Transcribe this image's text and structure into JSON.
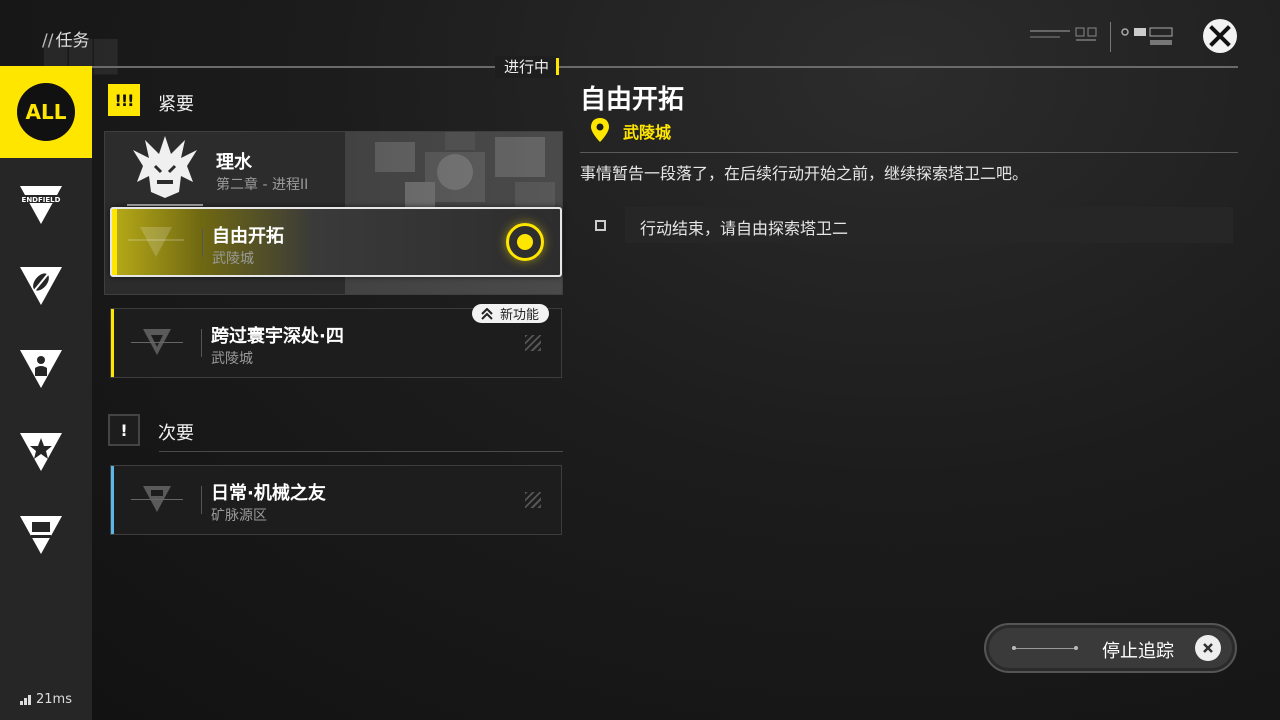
{
  "header": {
    "title": "任务",
    "status_tab": "进行中"
  },
  "sidebar": {
    "all_label": "ALL",
    "items": [
      {
        "icon": "endfield-icon",
        "label": "ENDFIELD"
      },
      {
        "icon": "leaf-icon"
      },
      {
        "icon": "person-icon"
      },
      {
        "icon": "star-icon"
      },
      {
        "icon": "machine-icon"
      }
    ]
  },
  "sections": {
    "urgent": {
      "badge": "!!!",
      "label": "紧要"
    },
    "minor": {
      "badge": "!",
      "label": "次要"
    }
  },
  "quest_group": {
    "title": "理水",
    "subtitle": "第二章 - 进程II"
  },
  "quests": [
    {
      "title": "自由开拓",
      "location": "武陵城",
      "selected": true,
      "tracked": true
    },
    {
      "title": "跨过寰宇深处·四",
      "location": "武陵城",
      "badge": "新功能"
    },
    {
      "title": "日常·机械之友",
      "location": "矿脉源区"
    }
  ],
  "detail": {
    "title": "自由开拓",
    "location": "武陵城",
    "description": "事情暂告一段落了，在后续行动开始之前，继续探索塔卫二吧。",
    "objectives": [
      {
        "text": "行动结束，请自由探索塔卫二"
      }
    ]
  },
  "actions": {
    "stop_tracking": "停止追踪"
  },
  "status": {
    "ping": "21ms"
  },
  "colors": {
    "accent": "#ffe600",
    "minor_bar": "#59b8e8",
    "urgent_bar": "#ffe600"
  }
}
